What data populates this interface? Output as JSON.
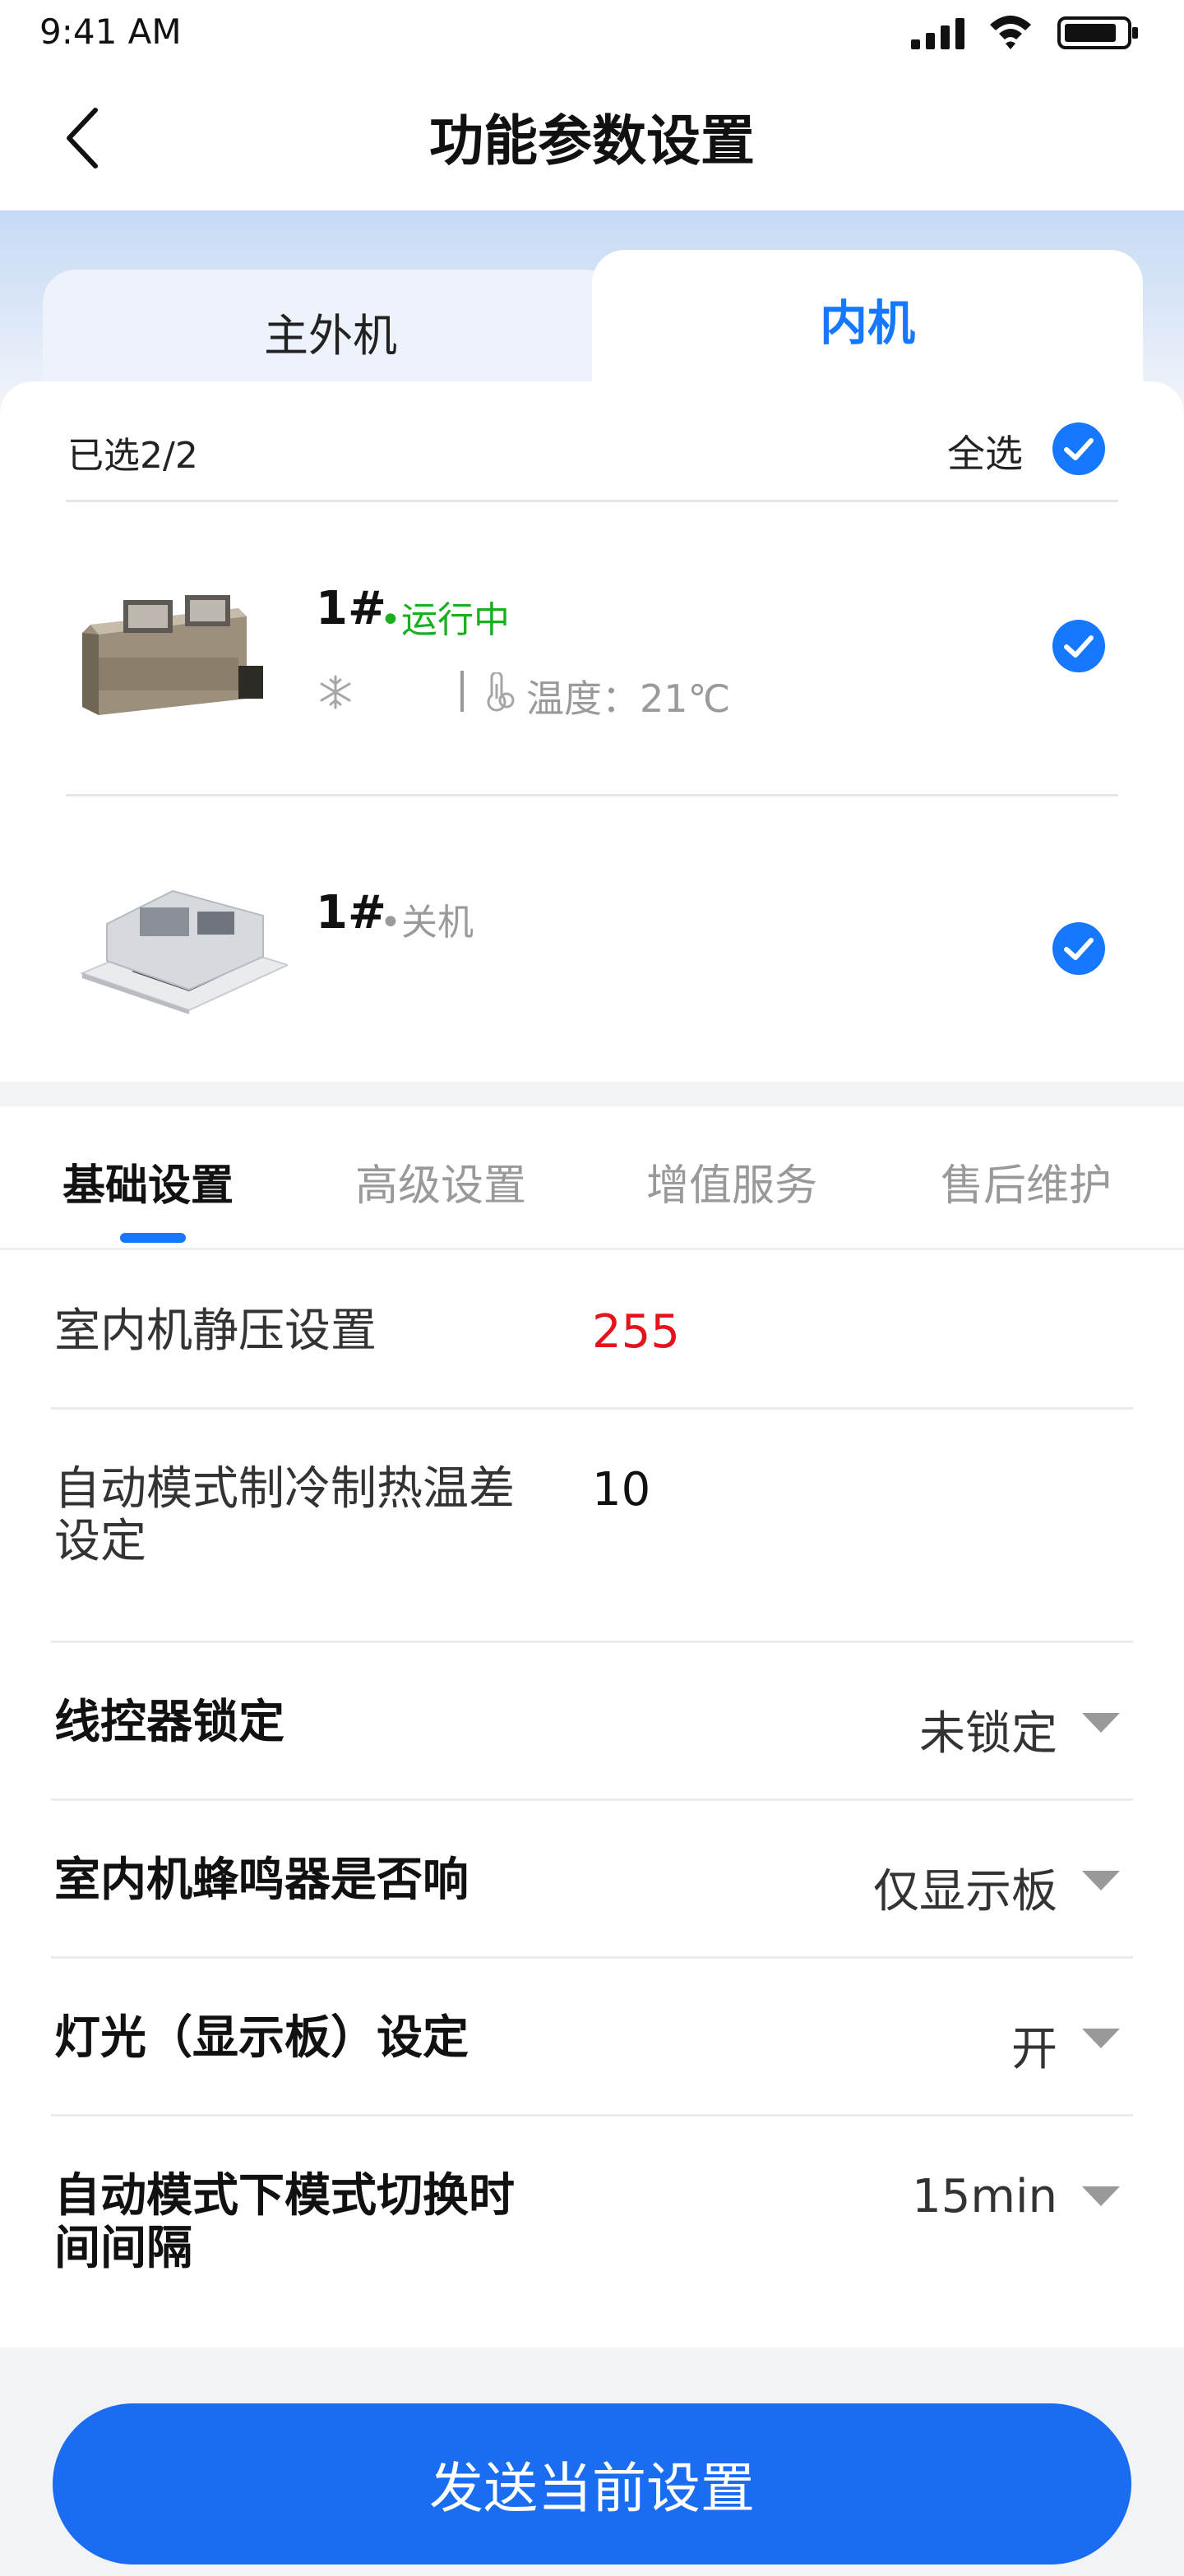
{
  "status_bar": {
    "time": "9:41 AM"
  },
  "nav": {
    "title": "功能参数设置"
  },
  "unit_tabs": {
    "outdoor": "主外机",
    "indoor": "内机"
  },
  "selection": {
    "count": "已选2/2",
    "select_all": "全选"
  },
  "units": [
    {
      "name": "1#",
      "status": "•运行中",
      "status_color": "#19b020",
      "temp": "温度：21℃",
      "mode_icon": "snowflake-icon"
    },
    {
      "name": "1#",
      "status": "•关机",
      "status_color": "#9a9a9a"
    }
  ],
  "settings_tabs": [
    "基础设置",
    "高级设置",
    "增值服务",
    "售后维护"
  ],
  "settings": [
    {
      "label": "室内机静压设置",
      "value": "255",
      "value_color": "#e5141c"
    },
    {
      "label": "自动模式制冷制热温差设定",
      "value": "10"
    },
    {
      "label": "线控器锁定",
      "value": "未锁定"
    },
    {
      "label": "室内机蜂鸣器是否响",
      "value": "仅显示板"
    },
    {
      "label": "灯光（显示板）设定",
      "value": "开"
    },
    {
      "label": "自动模式下模式切换时间间隔",
      "value": "15min"
    }
  ],
  "send_button": "发送当前设置",
  "colors": {
    "accent": "#1677ff",
    "button": "#1a6df0",
    "running": "#19b020",
    "alert": "#e5141c"
  }
}
